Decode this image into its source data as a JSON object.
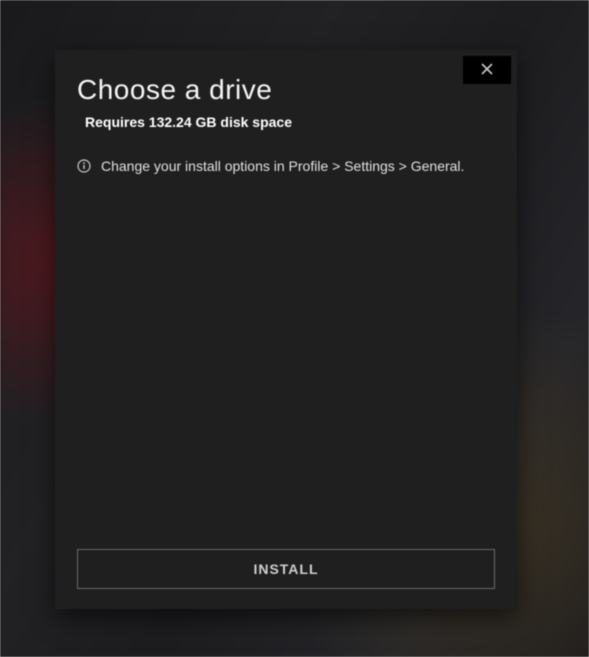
{
  "modal": {
    "title": "Choose a drive",
    "requires": "Requires 132.24 GB disk space",
    "info": "Change your install options in Profile > Settings > General.",
    "install_label": "INSTALL"
  }
}
